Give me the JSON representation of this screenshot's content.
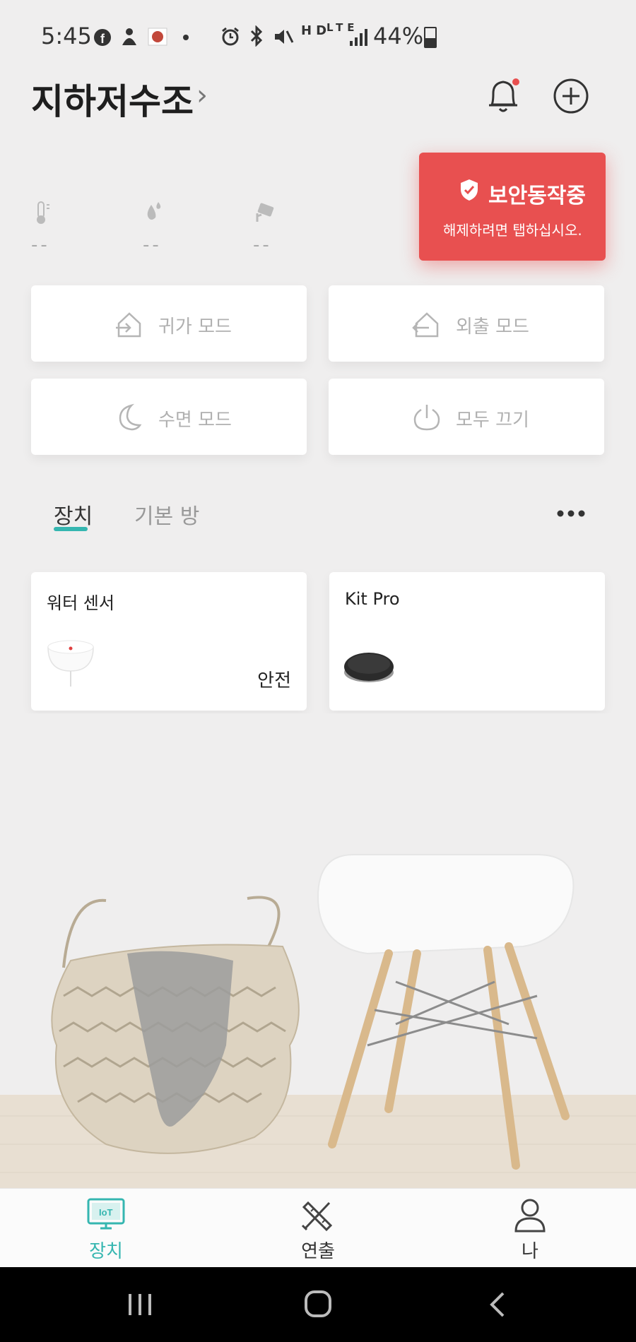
{
  "status_bar": {
    "time": "5:45",
    "left_icons": [
      "facebook-icon",
      "app-icon",
      "app-icon",
      "dot-icon"
    ],
    "right_icons": [
      "alarm-icon",
      "bluetooth-icon",
      "mute-icon",
      "hd-voice-icon",
      "lte-icon",
      "signal-icon"
    ],
    "hd_label": "HD",
    "lte_label": "LTE",
    "battery": "44%"
  },
  "header": {
    "title": "지하저수조",
    "notification_dot_color": "#e85050"
  },
  "sensors": [
    {
      "icon": "thermometer-icon",
      "value": "--"
    },
    {
      "icon": "humidity-icon",
      "value": "--"
    },
    {
      "icon": "camera-icon",
      "value": "--"
    }
  ],
  "security": {
    "title": "보안동작중",
    "subtitle": "해제하려면 탭하십시오.",
    "color": "#e85050"
  },
  "modes": [
    {
      "label": "귀가 모드",
      "icon": "home-in-icon"
    },
    {
      "label": "외출 모드",
      "icon": "home-out-icon"
    },
    {
      "label": "수면 모드",
      "icon": "moon-icon"
    },
    {
      "label": "모두 끄기",
      "icon": "power-icon"
    }
  ],
  "tabs": [
    {
      "label": "장치",
      "active": true
    },
    {
      "label": "기본 방",
      "active": false
    }
  ],
  "accent_color": "#35b6b0",
  "devices": [
    {
      "name": "워터 센서",
      "status": "안전",
      "icon": "water-sensor-icon"
    },
    {
      "name": "Kit Pro",
      "status": "",
      "icon": "kit-pro-icon"
    }
  ],
  "bottom_nav": [
    {
      "label": "장치",
      "icon": "iot-monitor-icon",
      "active": true,
      "icon_text": "IoT"
    },
    {
      "label": "연출",
      "icon": "tools-icon",
      "active": false
    },
    {
      "label": "나",
      "icon": "person-icon",
      "active": false
    }
  ]
}
